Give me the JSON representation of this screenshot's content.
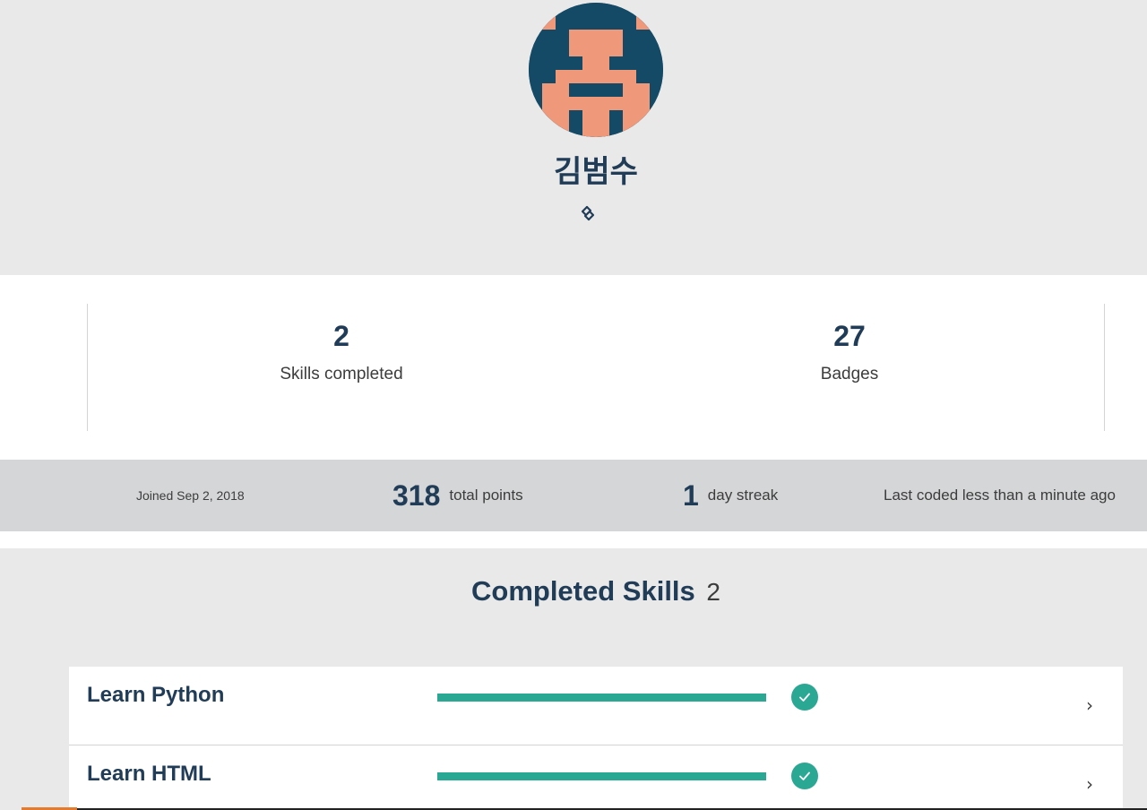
{
  "profile": {
    "name": "김범수",
    "link_icon": "link-icon",
    "avatar_colors": {
      "background": "#154a66",
      "foreground": "#f0987a"
    }
  },
  "stats": {
    "skills_completed": {
      "value": "2",
      "label": "Skills completed"
    },
    "badges": {
      "value": "27",
      "label": "Badges"
    }
  },
  "info": {
    "joined": "Joined Sep 2, 2018",
    "points_value": "318",
    "points_label": "total points",
    "streak_value": "1",
    "streak_label": "day streak",
    "last_coded": "Last coded less than a minute ago"
  },
  "completed_skills": {
    "title": "Completed Skills",
    "count": "2",
    "items": [
      {
        "name": "Learn Python",
        "progress": 1.0,
        "status_icon": "check-circle-icon",
        "chevron": "›"
      },
      {
        "name": "Learn HTML",
        "progress": 1.0,
        "status_icon": "check-circle-icon",
        "chevron": "›"
      }
    ]
  },
  "colors": {
    "accent": "#2aa893",
    "heading": "#213c57",
    "page_bg": "#e9e9e9",
    "info_bar": "#d5d6d8"
  }
}
